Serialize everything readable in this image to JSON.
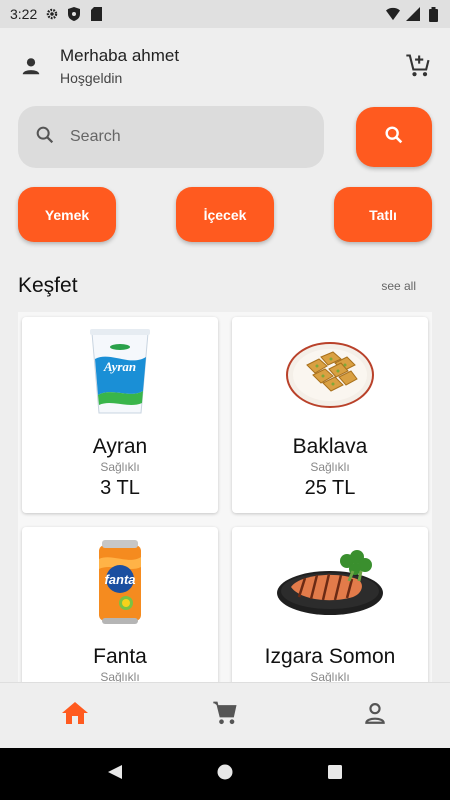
{
  "status_bar": {
    "time": "3:22"
  },
  "header": {
    "greeting": "Merhaba ahmet",
    "subtitle": "Hoşgeldin"
  },
  "search": {
    "placeholder": "Search"
  },
  "categories": [
    "Yemek",
    "İçecek",
    "Tatlı"
  ],
  "section": {
    "title": "Keşfet",
    "see_all": "see all"
  },
  "products": [
    {
      "name": "Ayran",
      "tag": "Sağlıklı",
      "price": "3 TL",
      "icon": "ayran-cup"
    },
    {
      "name": "Baklava",
      "tag": "Sağlıklı",
      "price": "25 TL",
      "icon": "baklava-plate"
    },
    {
      "name": "Fanta",
      "tag": "Sağlıklı",
      "price": "",
      "icon": "fanta-can"
    },
    {
      "name": "Izgara Somon",
      "tag": "Sağlıklı",
      "price": "",
      "icon": "salmon-plate"
    }
  ],
  "bottom_nav": [
    "home-icon",
    "cart-icon",
    "person-icon"
  ],
  "colors": {
    "accent": "#ff5a1f",
    "background": "#eeeeee"
  }
}
